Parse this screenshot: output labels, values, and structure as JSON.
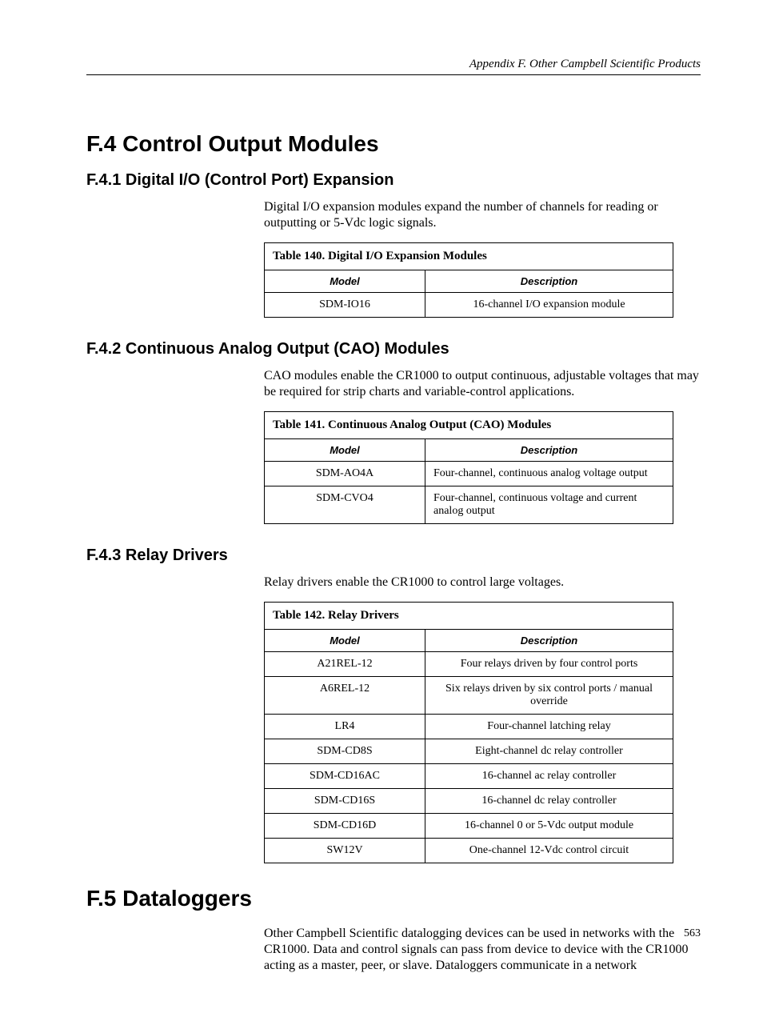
{
  "runningHead": "Appendix F.  Other Campbell Scientific Products",
  "pageNumber": "563",
  "sections": {
    "f4": {
      "title": "F.4 Control Output Modules",
      "f4_1": {
        "title": "F.4.1 Digital I/O (Control Port) Expansion",
        "body": "Digital I/O expansion modules expand the number of channels for reading or outputting or 5-Vdc logic signals.",
        "table": {
          "caption": "Table 140. Digital I/O Expansion Modules",
          "h_model": "Model",
          "h_desc": "Description",
          "rows": [
            {
              "model": "SDM-IO16",
              "desc": "16-channel I/O expansion module"
            }
          ]
        }
      },
      "f4_2": {
        "title": "F.4.2 Continuous Analog Output (CAO) Modules",
        "body": "CAO modules enable the CR1000 to output continuous, adjustable voltages that may be required for strip charts and variable-control applications.",
        "table": {
          "caption": "Table 141. Continuous Analog Output (CAO) Modules",
          "h_model": "Model",
          "h_desc": "Description",
          "rows": [
            {
              "model": "SDM-AO4A",
              "desc": "Four-channel, continuous analog voltage output"
            },
            {
              "model": "SDM-CVO4",
              "desc": "Four-channel, continuous voltage and current analog output"
            }
          ]
        }
      },
      "f4_3": {
        "title": "F.4.3 Relay Drivers",
        "body": "Relay drivers enable the CR1000 to control large voltages.",
        "table": {
          "caption": "Table 142. Relay Drivers",
          "h_model": "Model",
          "h_desc": "Description",
          "rows": [
            {
              "model": "A21REL-12",
              "desc": "Four relays driven by four control ports"
            },
            {
              "model": "A6REL-12",
              "desc": "Six relays driven by six control ports / manual override"
            },
            {
              "model": "LR4",
              "desc": "Four-channel latching relay"
            },
            {
              "model": "SDM-CD8S",
              "desc": "Eight-channel dc relay controller"
            },
            {
              "model": "SDM-CD16AC",
              "desc": "16-channel ac relay controller"
            },
            {
              "model": "SDM-CD16S",
              "desc": "16-channel dc relay controller"
            },
            {
              "model": "SDM-CD16D",
              "desc": "16-channel 0 or 5-Vdc output module"
            },
            {
              "model": "SW12V",
              "desc": "One-channel 12-Vdc control circuit"
            }
          ]
        }
      }
    },
    "f5": {
      "title": "F.5 Dataloggers",
      "body": "Other Campbell Scientific datalogging devices can be used in networks with the CR1000. Data and control signals can pass from device to device with the CR1000 acting as a master, peer, or slave. Dataloggers communicate in a network"
    }
  }
}
